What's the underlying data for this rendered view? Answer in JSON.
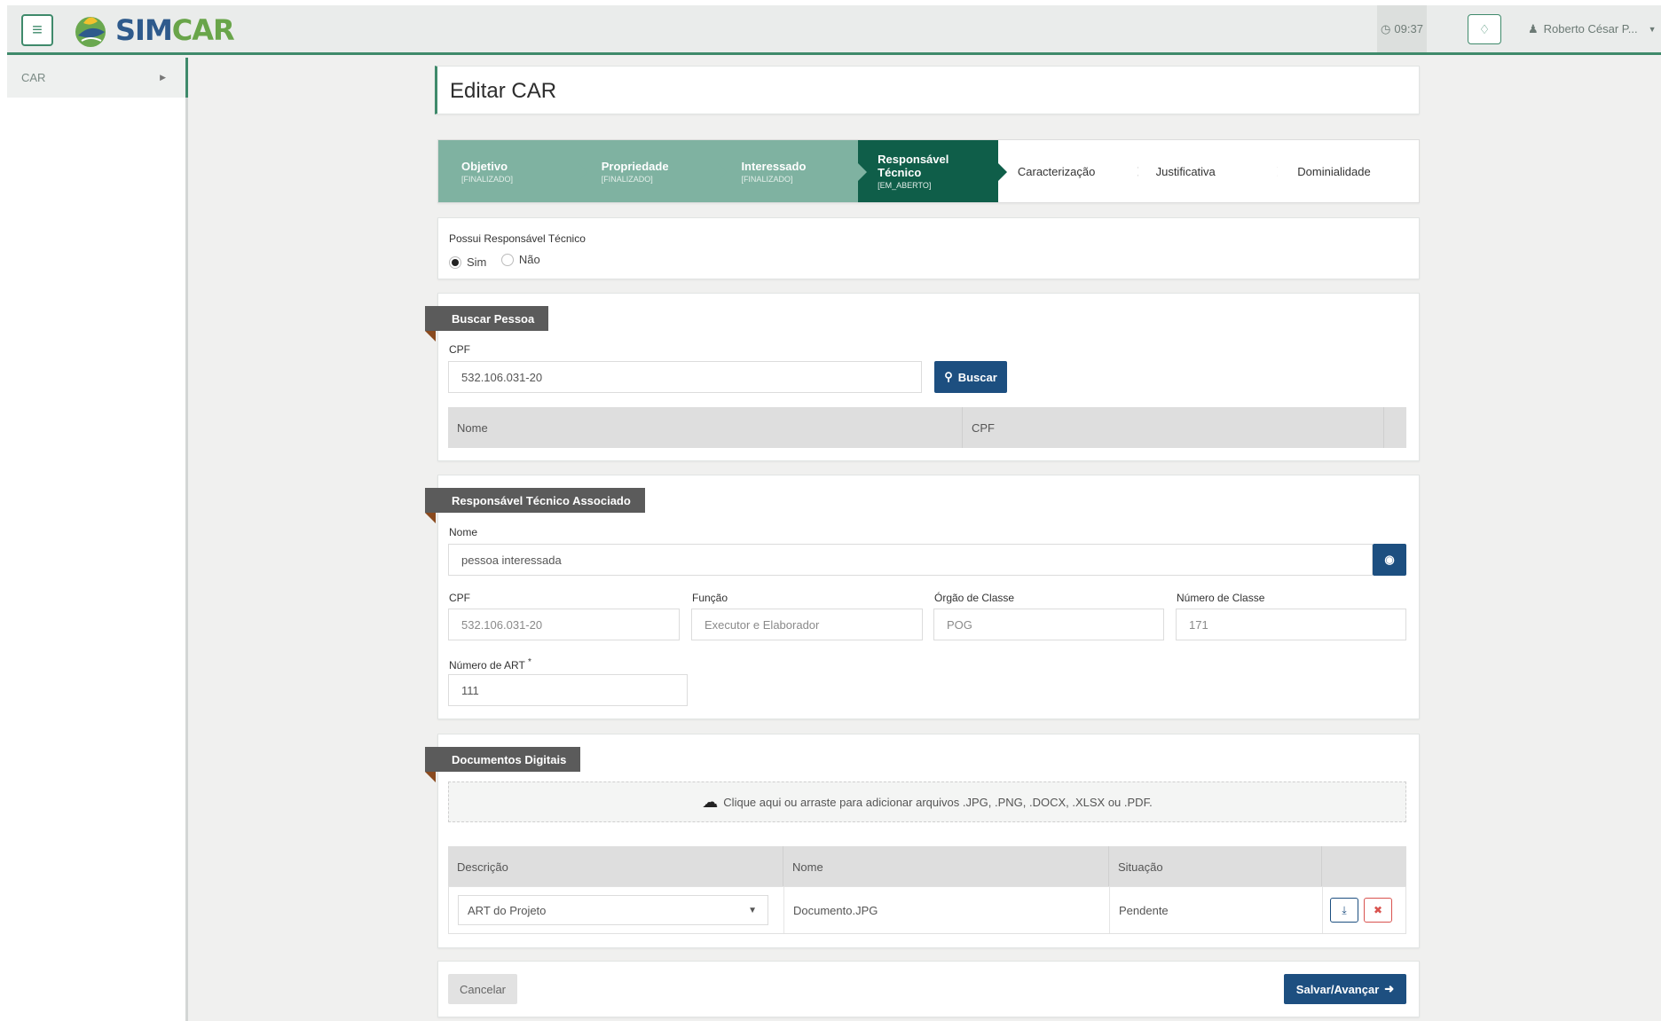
{
  "header": {
    "menu_icon": "hamburger-icon",
    "logo_sim": "SIM",
    "logo_car": "CAR",
    "clock": "09:37",
    "user_name": "Roberto César P..."
  },
  "sidebar": {
    "items": [
      {
        "label": "CAR"
      }
    ]
  },
  "page": {
    "title": "Editar CAR"
  },
  "wizard": {
    "steps": [
      {
        "label": "Objetivo",
        "status": "[FINALIZADO]"
      },
      {
        "label": "Propriedade",
        "status": "[FINALIZADO]"
      },
      {
        "label": "Interessado",
        "status": "[FINALIZADO]"
      },
      {
        "label": "Responsável Técnico",
        "status": "[EM_ABERTO]"
      },
      {
        "label": "Caracterização",
        "status": ""
      },
      {
        "label": "Justificativa",
        "status": ""
      },
      {
        "label": "Dominialidade",
        "status": ""
      }
    ]
  },
  "possui": {
    "label": "Possui Responsável Técnico",
    "option_yes": "Sim",
    "option_no": "Não"
  },
  "buscar": {
    "section": "Buscar Pessoa",
    "cpf_label": "CPF",
    "cpf_value": "532.106.031-20",
    "button": "Buscar",
    "col_nome": "Nome",
    "col_cpf": "CPF"
  },
  "associado": {
    "section": "Responsável Técnico Associado",
    "nome_label": "Nome",
    "nome_value": "pessoa interessada",
    "cpf_label": "CPF",
    "cpf_value": "532.106.031-20",
    "funcao_label": "Função",
    "funcao_value": "Executor e Elaborador",
    "orgao_label": "Órgão de Classe",
    "orgao_value": "POG",
    "numero_label": "Número de Classe",
    "numero_value": "171",
    "art_label": "Número de ART",
    "art_required": "*",
    "art_value": "111"
  },
  "documentos": {
    "section": "Documentos Digitais",
    "dropzone": "Clique aqui ou arraste para adicionar arquivos .JPG, .PNG, .DOCX, .XLSX ou .PDF.",
    "col_descricao": "Descrição",
    "col_nome": "Nome",
    "col_situacao": "Situação",
    "rows": [
      {
        "descricao": "ART do Projeto",
        "nome": "Documento.JPG",
        "situacao": "Pendente"
      }
    ]
  },
  "footer": {
    "cancel": "Cancelar",
    "save": "Salvar/Avançar"
  },
  "colors": {
    "primary_green": "#3f8a6b",
    "done_step": "#7fb2a1",
    "active_step": "#0f5e49",
    "button_blue": "#1d4f80",
    "danger": "#d9534f"
  }
}
